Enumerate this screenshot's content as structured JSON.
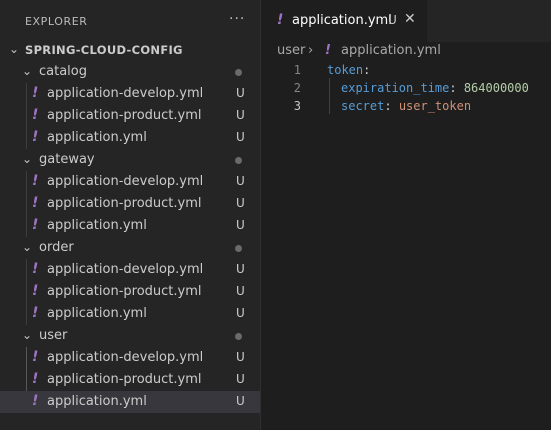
{
  "explorer": {
    "title": "EXPLORER",
    "more": "···",
    "root": {
      "label": "SPRING-CLOUD-CONFIG"
    },
    "folders": [
      {
        "name": "catalog",
        "files": [
          {
            "name": "application-develop.yml",
            "status": "U"
          },
          {
            "name": "application-product.yml",
            "status": "U"
          },
          {
            "name": "application.yml",
            "status": "U"
          }
        ]
      },
      {
        "name": "gateway",
        "files": [
          {
            "name": "application-develop.yml",
            "status": "U"
          },
          {
            "name": "application-product.yml",
            "status": "U"
          },
          {
            "name": "application.yml",
            "status": "U"
          }
        ]
      },
      {
        "name": "order",
        "files": [
          {
            "name": "application-develop.yml",
            "status": "U"
          },
          {
            "name": "application-product.yml",
            "status": "U"
          },
          {
            "name": "application.yml",
            "status": "U"
          }
        ]
      },
      {
        "name": "user",
        "files": [
          {
            "name": "application-develop.yml",
            "status": "U"
          },
          {
            "name": "application-product.yml",
            "status": "U"
          },
          {
            "name": "application.yml",
            "status": "U"
          }
        ]
      }
    ],
    "selected": "user/application.yml"
  },
  "editor": {
    "tab": {
      "name": "application.yml",
      "status": "U",
      "close": "✕"
    },
    "breadcrumb": {
      "folder": "user",
      "separator": "›",
      "file": "application.yml"
    },
    "lines": [
      {
        "num": "1",
        "key": "token",
        "colon": ":",
        "value": ""
      },
      {
        "num": "2",
        "key": "expiration_time",
        "colon": ": ",
        "value": "864000000"
      },
      {
        "num": "3",
        "key": "secret",
        "colon": ": ",
        "value": "user_token"
      }
    ],
    "current_line": 3
  },
  "icons": {
    "yaml": "!",
    "chevron_down": "⌄"
  },
  "colors": {
    "sidebar_bg": "#252526",
    "editor_bg": "#1e1e1e",
    "selection_bg": "#37373d",
    "yaml_icon": "#a074c4",
    "yaml_key": "#569cd6",
    "yaml_number": "#b5cea8",
    "yaml_string": "#ce9178"
  }
}
